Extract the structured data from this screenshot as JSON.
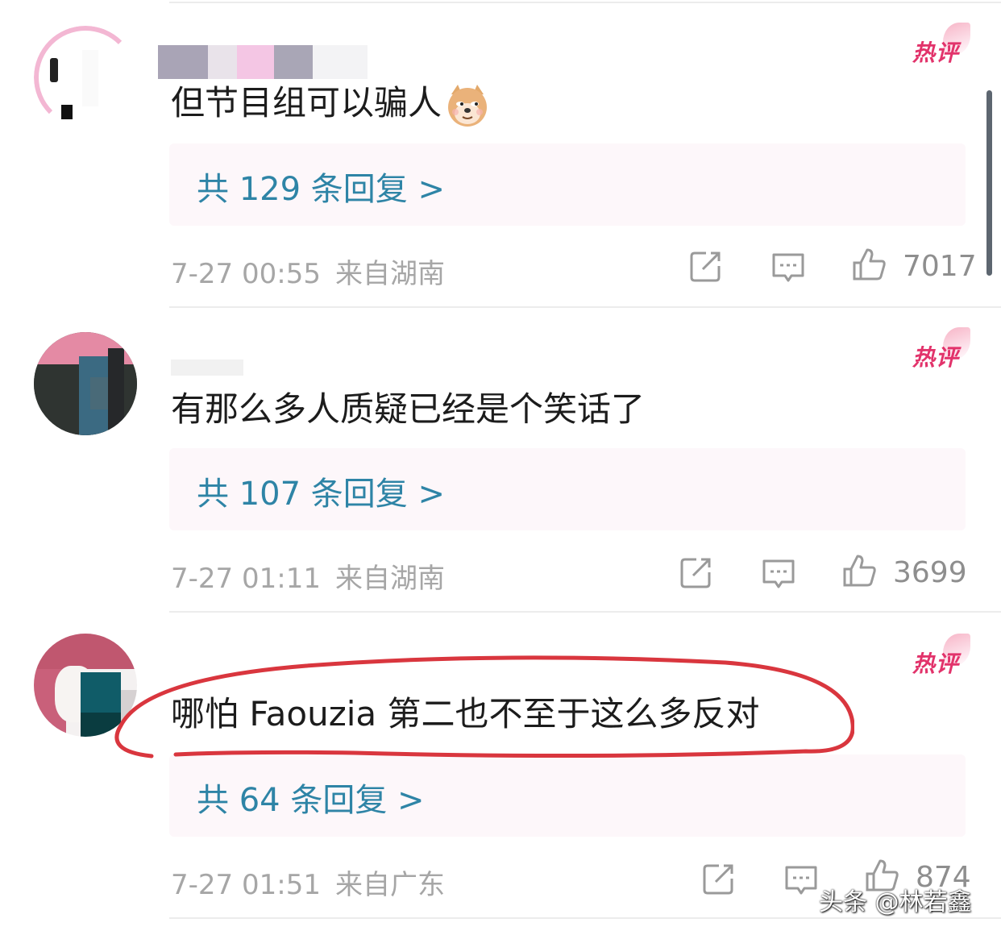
{
  "comments": [
    {
      "badge": "热评",
      "text": "但节目组可以骗人",
      "emoji": "doge-emoji",
      "replies_label": "共 129 条回复 >",
      "date": "7-27 00:55",
      "location": "来自湖南",
      "likes": "7017"
    },
    {
      "badge": "热评",
      "text": "有那么多人质疑已经是个笑话了",
      "replies_label": "共 107 条回复 >",
      "date": "7-27 01:11",
      "location": "来自湖南",
      "likes": "3699"
    },
    {
      "badge": "热评",
      "text": "哪怕 Faouzia 第二也不至于这么多反对",
      "replies_label": "共 64 条回复 >",
      "date": "7-27 01:51",
      "location": "来自广东",
      "likes": "874"
    }
  ],
  "icons": {
    "share": "share-icon",
    "comment": "comment-icon",
    "like": "thumbs-up-icon"
  },
  "colors": {
    "hot_badge": "#e2336b",
    "reply_link": "#2e84a6",
    "annotation_circle": "#d9363e"
  },
  "watermark": "头条 @林若鑫"
}
